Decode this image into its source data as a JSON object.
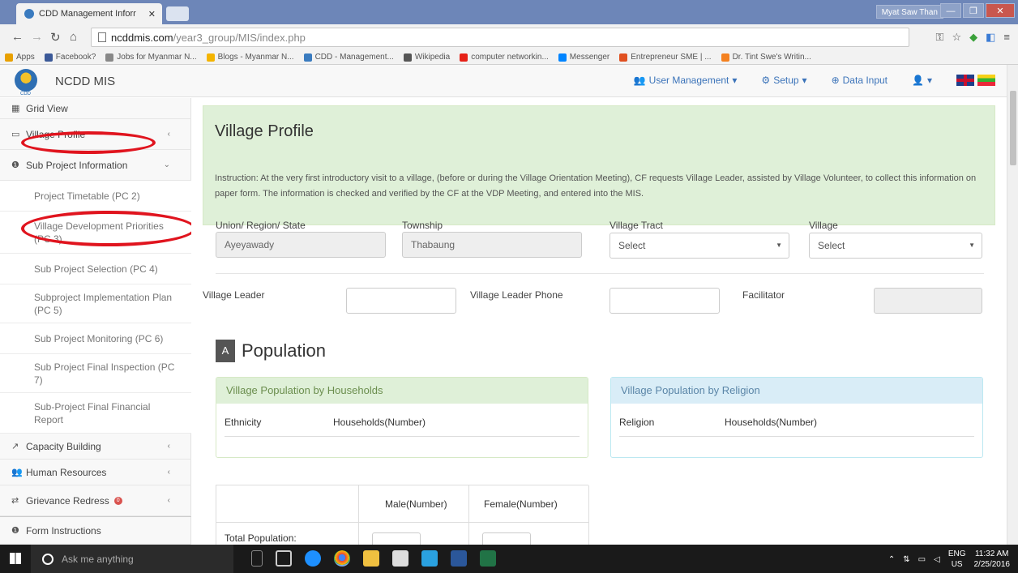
{
  "browser": {
    "tab_title": "CDD Management Inforr",
    "user_badge": "Myat Saw Than",
    "url_host": "ncddmis.com",
    "url_path": "/year3_group/MIS/index.php",
    "bookmarks": [
      {
        "label": "Apps",
        "color": "#e8a000"
      },
      {
        "label": "Facebook?",
        "color": "#3b5998"
      },
      {
        "label": "Jobs for Myanmar N...",
        "color": "#888888"
      },
      {
        "label": "Blogs - Myanmar N...",
        "color": "#f4b400"
      },
      {
        "label": "CDD - Management...",
        "color": "#3a7bbf"
      },
      {
        "label": "Wikipedia",
        "color": "#555555"
      },
      {
        "label": "computer networkin...",
        "color": "#e62117"
      },
      {
        "label": "Messenger",
        "color": "#0084ff"
      },
      {
        "label": "Entrepreneur SME | ...",
        "color": "#e05020"
      },
      {
        "label": "Dr. Tint Swe's Writin...",
        "color": "#f48120"
      }
    ]
  },
  "app": {
    "brand": "NCDD MIS",
    "logo_text": "CDD",
    "nav": {
      "user_management": "User Management",
      "setup": "Setup",
      "data_input": "Data Input"
    }
  },
  "sidebar": {
    "grid_view": "Grid View",
    "village_profile": "Village Profile",
    "sub_project_information": "Sub Project Information",
    "subitems": [
      "Project Timetable (PC 2)",
      "Village Development Priorities (PC 3)",
      "Sub Project Selection (PC 4)",
      "Subproject Implementation Plan (PC 5)",
      "Sub Project Monitoring (PC 6)",
      "Sub Project Final Inspection (PC 7)",
      "Sub-Project Final Financial Report"
    ],
    "capacity_building": "Capacity Building",
    "human_resources": "Human Resources",
    "grievance_redress": "Grievance Redress",
    "grievance_badge": "0",
    "form_instructions": "Form Instructions"
  },
  "main": {
    "title": "Village Profile",
    "instruction": "Instruction: At the very first introductory visit to a village, (before or during the Village Orientation Meeting), CF requests Village Leader, assisted by Village Volunteer, to collect this information on paper form. The information is checked and verified by the CF at the VDP Meeting, and entered into the MIS.",
    "labels": {
      "region": "Union/ Region/ State",
      "township": "Township",
      "village_tract": "Village Tract",
      "village": "Village",
      "village_leader": "Village Leader",
      "leader_phone": "Village Leader Phone",
      "facilitator": "Facilitator"
    },
    "values": {
      "region": "Ayeyawady",
      "township": "Thabaung",
      "village_tract": "Select",
      "village": "Select"
    },
    "section_letter": "A",
    "section_title": "Population",
    "households_panel": {
      "title": "Village Population by Households",
      "col1": "Ethnicity",
      "col2": "Households(Number)"
    },
    "religion_panel": {
      "title": "Village Population by Religion",
      "col1": "Religion",
      "col2": "Households(Number)"
    },
    "population_table": {
      "male": "Male(Number)",
      "female": "Female(Number)",
      "total_label": "Total Population:"
    }
  },
  "taskbar": {
    "search": "Ask me anything",
    "lang_top": "ENG",
    "lang_bottom": "US",
    "time": "11:32 AM",
    "date": "2/25/2016"
  }
}
